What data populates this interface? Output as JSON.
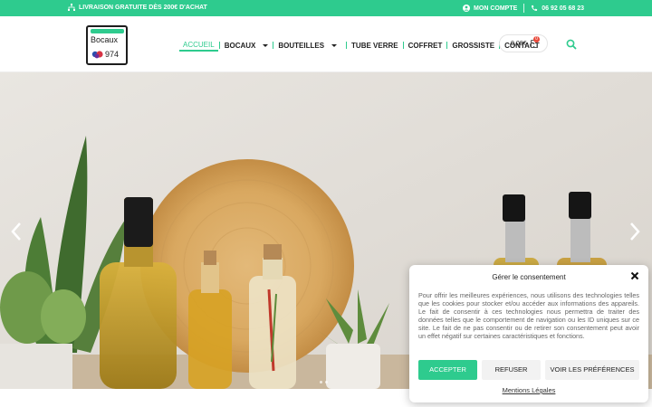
{
  "topbar": {
    "shipping": "LIVRAISON GRATUITE DÈS 200€ D'ACHAT",
    "account": "MON COMPTE",
    "phone": "06 92 05 68 23"
  },
  "logo": {
    "line1": "Bocaux",
    "line2": "974"
  },
  "nav": {
    "home": "ACCUEIL",
    "jars": "BOCAUX",
    "bottles": "BOUTEILLES",
    "tube": "TUBE VERRE",
    "box": "COFFRET",
    "wholesale": "GROSSISTE",
    "contact": "CONTACT"
  },
  "cart": {
    "amount": "0,00€",
    "count": "0"
  },
  "colors": {
    "accent": "#2ecb8e",
    "badge": "#e84b3c"
  },
  "consent": {
    "title": "Gérer le consentement",
    "body": "Pour offrir les meilleures expériences, nous utilisons des technologies telles que les cookies pour stocker et/ou accéder aux informations des appareils. Le fait de consentir à ces technologies nous permettra de traiter des données telles que le comportement de navigation ou les ID uniques sur ce site. Le fait de ne pas consentir ou de retirer son consentement peut avoir un effet négatif sur certaines caractéristiques et fonctions.",
    "accept": "ACCEPTER",
    "refuse": "REFUSER",
    "prefs": "VOIR LES PRÉFÉRENCES",
    "legal": "Mentions Légales"
  }
}
